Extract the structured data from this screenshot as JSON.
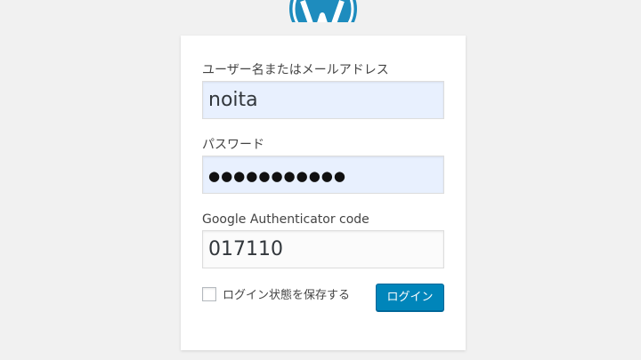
{
  "branding": {
    "logo_icon": "wordpress-logo-icon",
    "logo_color": "#1e8cbe"
  },
  "login_form": {
    "username": {
      "label": "ユーザー名またはメールアドレス",
      "value": "noita"
    },
    "password": {
      "label": "パスワード",
      "value": "●●●●●●●●●●●"
    },
    "authenticator": {
      "label": "Google Authenticator code",
      "value": "017110"
    },
    "remember_me": {
      "label": "ログイン状態を保存する",
      "checked": false
    },
    "submit_label": "ログイン"
  },
  "colors": {
    "page_background": "#f1f1f1",
    "autofill_background": "#e8f0fe",
    "primary_button": "#0085ba"
  }
}
